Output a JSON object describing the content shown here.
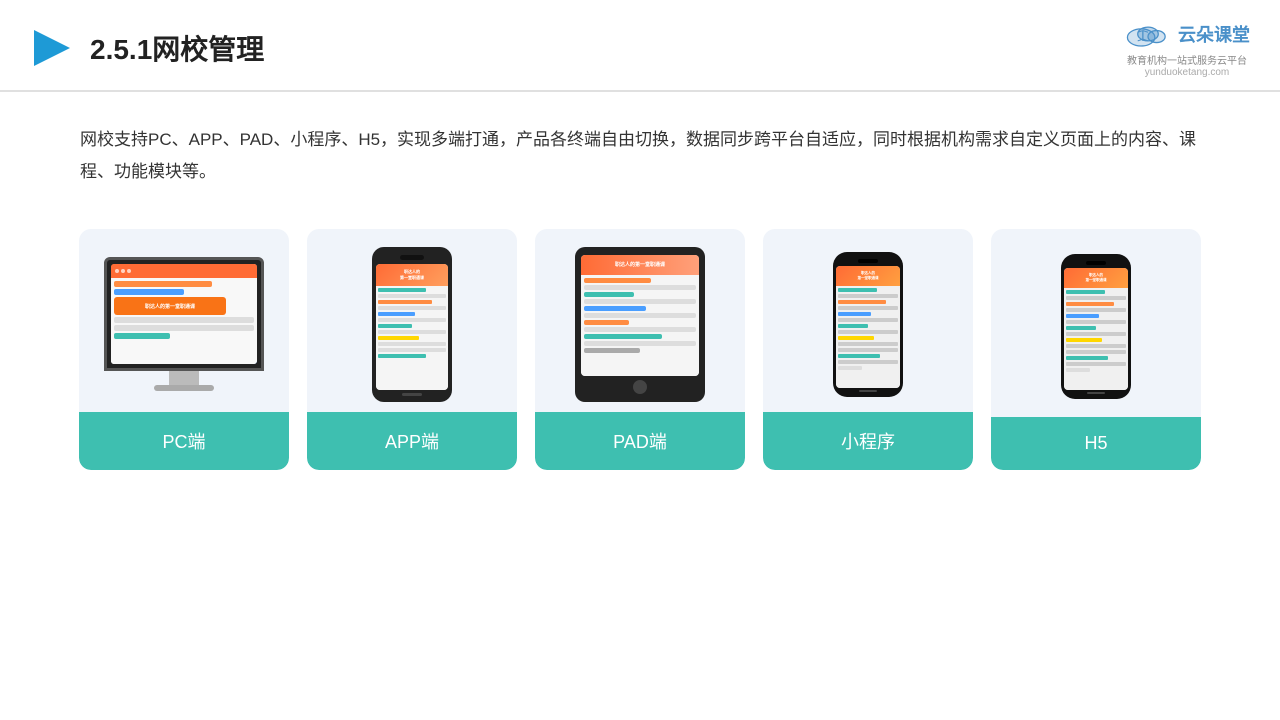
{
  "header": {
    "title": "2.5.1网校管理",
    "logo_main": "云朵课堂",
    "logo_url": "yunduoketang.com",
    "logo_tagline": "教育机构一站式服务云平台"
  },
  "description": {
    "text": "网校支持PC、APP、PAD、小程序、H5，实现多端打通，产品各终端自由切换，数据同步跨平台自适应，同时根据机构需求自定义页面上的内容、课程、功能模块等。"
  },
  "cards": [
    {
      "id": "pc",
      "label": "PC端"
    },
    {
      "id": "app",
      "label": "APP端"
    },
    {
      "id": "pad",
      "label": "PAD端"
    },
    {
      "id": "miniapp",
      "label": "小程序"
    },
    {
      "id": "h5",
      "label": "H5"
    }
  ],
  "colors": {
    "accent": "#3ebfb0",
    "header_line": "#e0e0e0",
    "card_bg": "#f0f4fa",
    "title_color": "#222222"
  }
}
